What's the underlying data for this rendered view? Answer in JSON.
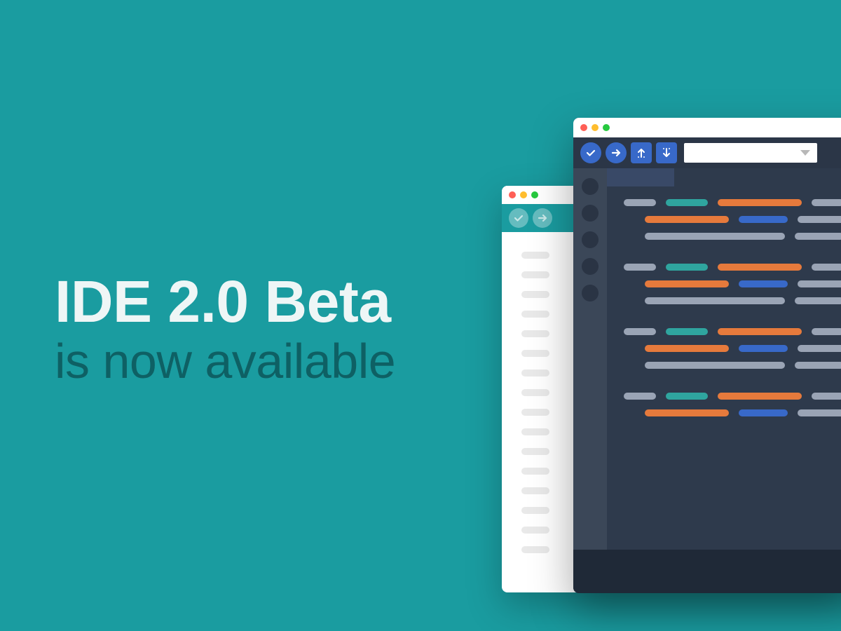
{
  "headline": {
    "title": "IDE 2.0 Beta",
    "subtitle": "is now available"
  },
  "colors": {
    "background": "#1a9ca0",
    "accent_blue": "#3869c9",
    "accent_orange": "#e67a3c",
    "accent_teal": "#2fa59f",
    "dark_panel": "#2e3a4c"
  },
  "old_ide": {
    "toolbar_icons": [
      "check-icon",
      "arrow-right-icon"
    ]
  },
  "new_ide": {
    "toolbar_icons": [
      "check-icon",
      "arrow-right-icon",
      "upload-icon",
      "download-icon"
    ],
    "dropdown_value": "",
    "sidebar_item_count": 5
  }
}
